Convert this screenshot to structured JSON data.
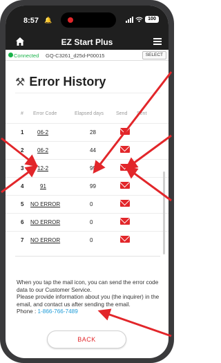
{
  "status_bar": {
    "time": "8:57",
    "battery": "100"
  },
  "nav": {
    "title": "EZ Start Plus"
  },
  "connection": {
    "status": "Connected",
    "device": "GQ-C3261_d25d-P00015",
    "select_label": "SELECT"
  },
  "page": {
    "title": "Error History"
  },
  "table": {
    "headers": {
      "no": "#",
      "code": "Error Code",
      "days": "Elapsed days",
      "send": "Send",
      "sent": "Sent"
    },
    "rows": [
      {
        "no": "1",
        "code": "06-2",
        "days": "28"
      },
      {
        "no": "2",
        "code": "06-2",
        "days": "44"
      },
      {
        "no": "3",
        "code": "12-2",
        "days": "99"
      },
      {
        "no": "4",
        "code": "91",
        "days": "99"
      },
      {
        "no": "5",
        "code": "NO ERROR",
        "days": "0"
      },
      {
        "no": "6",
        "code": "NO ERROR",
        "days": "0"
      },
      {
        "no": "7",
        "code": "NO ERROR",
        "days": "0"
      }
    ]
  },
  "info": {
    "line1": "When you tap the mail icon, you can send the error code data to our Customer Service.",
    "line2": "Please provide information about you (the inquirer) in the email, and contact us after sending the email.",
    "phone_label": "Phone : ",
    "phone_number": "1-866-766-7489"
  },
  "back_label": "BACK",
  "colors": {
    "accent": "#e2262a",
    "connected": "#19b34a",
    "link": "#1e9bd7",
    "header_bg": "#1f1f1f"
  },
  "icons": [
    "bell-icon",
    "signal-icon",
    "wifi-icon",
    "battery-icon",
    "home-icon",
    "menu-icon",
    "tools-icon",
    "mail-icon"
  ]
}
